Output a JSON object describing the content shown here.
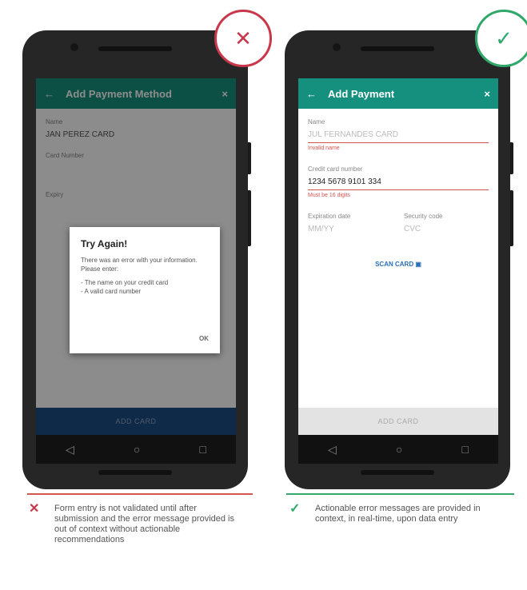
{
  "badges": {
    "bad_symbol": "✕",
    "good_symbol": "✓",
    "bad_color": "#c8374a",
    "good_color": "#2fa86a"
  },
  "left_phone": {
    "appbar_title": "Add Payment Method",
    "back_icon": "←",
    "close_icon": "×",
    "field1_label": "Name",
    "field1_value": "JAN PEREZ CARD",
    "field2_label": "Card Number",
    "field3_label": "Expiry",
    "dialog": {
      "title": "Try Again!",
      "message": "There was an error with your information. Please enter:",
      "hints": "- The name on your credit card\n- A valid card number",
      "ok_label": "OK"
    },
    "bottom_button": "ADD CARD"
  },
  "right_phone": {
    "back_icon": "←",
    "appbar_title": "Add Payment",
    "close_icon": "×",
    "name_label": "Name",
    "name_value": "JUL FERNANDES CARD",
    "name_error": "Invalid name",
    "card_label": "Credit card number",
    "card_value": "1234 5678 9101 334",
    "card_error": "Must be 16 digits",
    "expiry_label": "Expiration date",
    "expiry_value": "MM/YY",
    "security_label": "Security code",
    "security_value": "CVC",
    "scan_label": "SCAN CARD",
    "bottom_button": "ADD CARD"
  },
  "navbar_icons": {
    "back": "◁",
    "home": "○",
    "recent": "□"
  },
  "captions": {
    "bad_icon": "✕",
    "bad_text": "Form entry is not validated until after submission and the error message provided is out of context without actionable recommendations",
    "good_icon": "✓",
    "good_text": "Actionable error messages are provided in context, in real-time, upon data entry"
  }
}
